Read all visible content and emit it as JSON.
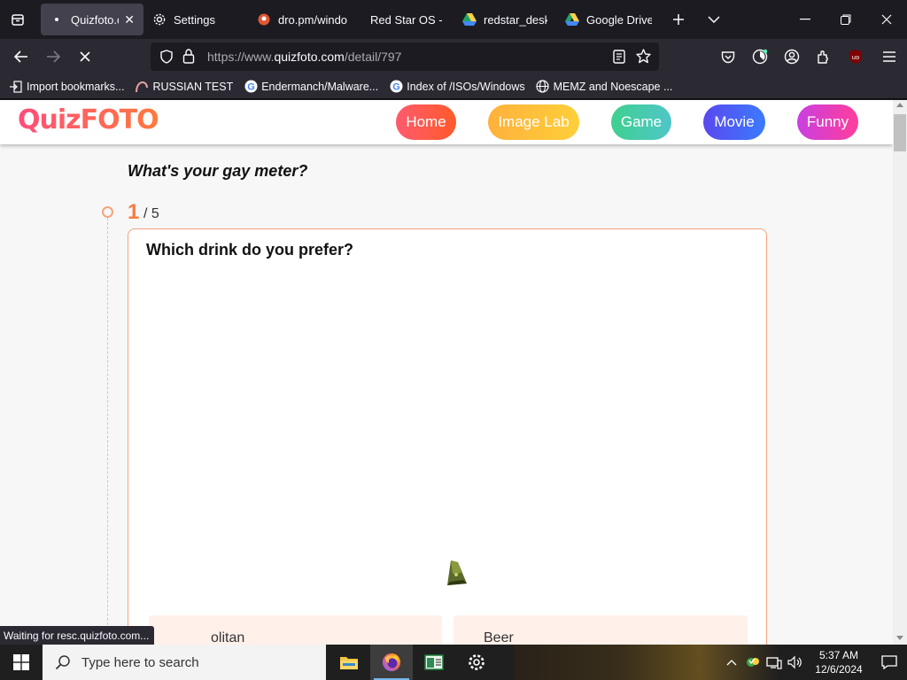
{
  "browser": {
    "tabs": [
      {
        "label": "Quizfoto.co",
        "active": true,
        "icon": "loading-dot-icon"
      },
      {
        "label": "Settings",
        "active": false,
        "icon": "gear-icon"
      },
      {
        "label": "dro.pm/windo",
        "active": false,
        "icon": "duckduckgo-icon"
      },
      {
        "label": "Red Star OS - /",
        "active": false,
        "icon": "none"
      },
      {
        "label": "redstar_deskto",
        "active": false,
        "icon": "google-drive-icon"
      },
      {
        "label": "Google Drive -",
        "active": false,
        "icon": "google-drive-icon"
      }
    ],
    "url": {
      "prefix": "https://www.",
      "domain": "quizfoto.com",
      "path": "/detail/797"
    },
    "bookmarks": [
      {
        "label": "Import bookmarks...",
        "icon": "import-icon"
      },
      {
        "label": "RUSSIAN TEST",
        "icon": "page-icon"
      },
      {
        "label": "Endermanch/Malware...",
        "icon": "google-icon"
      },
      {
        "label": "Index of /ISOs/Windows",
        "icon": "google-icon"
      },
      {
        "label": "MEMZ and Noescape ...",
        "icon": "globe-icon"
      }
    ],
    "status": "Waiting for resc.quizfoto.com..."
  },
  "site": {
    "logo": "QuizFOTO",
    "nav": {
      "home": "Home",
      "image_lab": "Image Lab",
      "game": "Game",
      "movie": "Movie",
      "funny": "Funny"
    },
    "colors": {
      "accent": "#f47d45",
      "card_border": "#f4a37c",
      "option_bg": "#fff0ea"
    }
  },
  "quiz": {
    "title": "What's your gay meter?",
    "step_current": "1",
    "step_total": "/ 5",
    "question": "Which drink do you prefer?",
    "options": [
      {
        "label": "olitan"
      },
      {
        "label": "Beer"
      }
    ]
  },
  "taskbar": {
    "search_placeholder": "Type here to search",
    "apps": [
      "file-explorer-icon",
      "firefox-icon",
      "app-window-icon",
      "settings-icon"
    ],
    "time": "5:37 AM",
    "date": "12/6/2024"
  }
}
